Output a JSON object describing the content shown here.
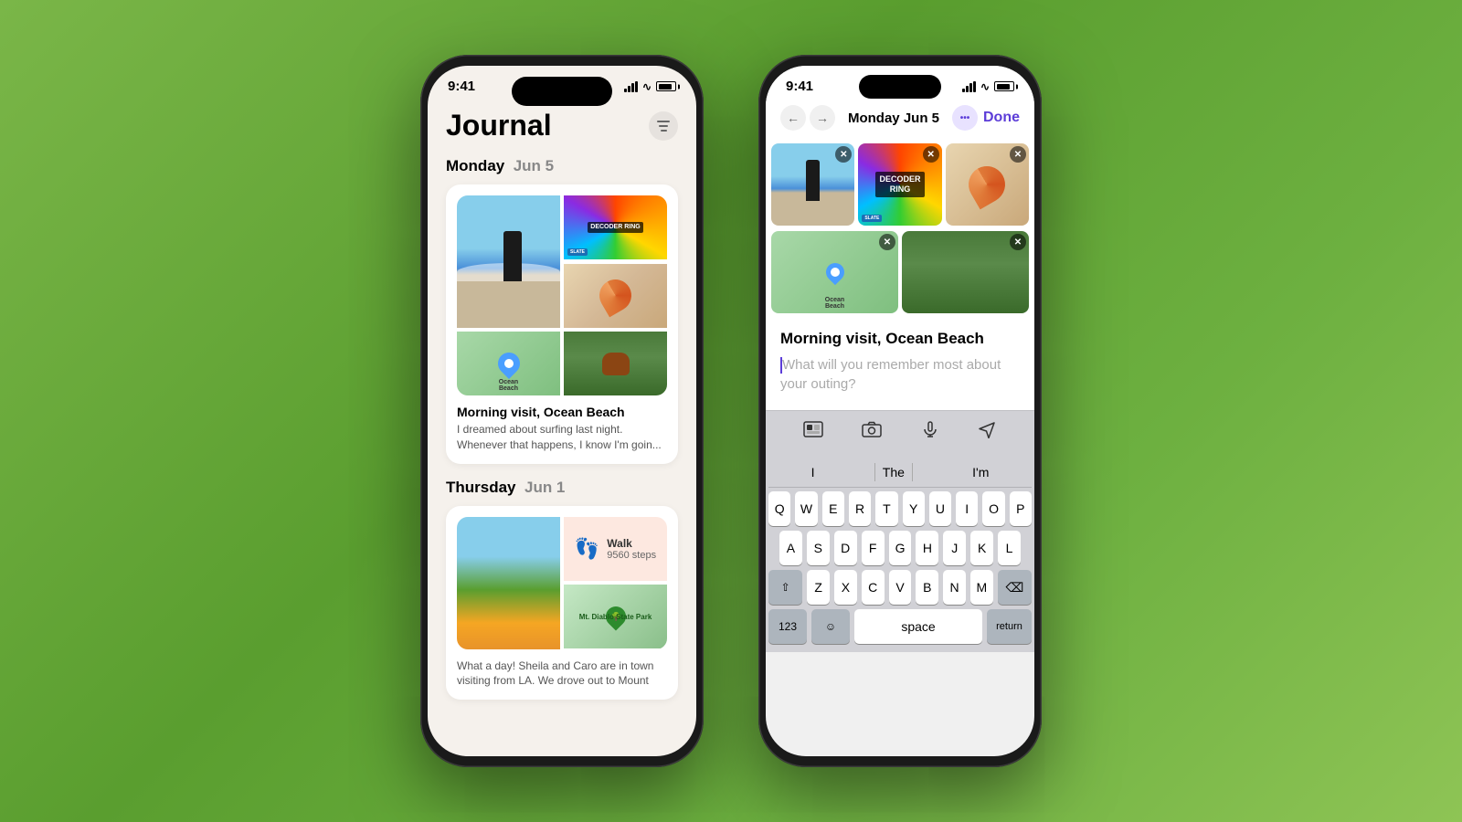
{
  "background": {
    "color": "#6db040"
  },
  "phone_left": {
    "status_bar": {
      "time": "9:41",
      "signal": "signal",
      "wifi": "wifi",
      "battery": "battery"
    },
    "journal": {
      "title": "Journal",
      "filter_label": "filter",
      "section1": {
        "day": "Monday",
        "date": "Jun 5"
      },
      "entry1": {
        "title": "Morning visit, Ocean Beach",
        "body": "I dreamed about surfing last night. Whenever that happens, I know I'm goin..."
      },
      "section2": {
        "day": "Thursday",
        "date": "Jun 1"
      },
      "entry2": {
        "walk_title": "Walk",
        "walk_steps": "9560 steps",
        "park_name": "Mt. Diablo State Park",
        "body": "What a day! Sheila and Caro are in town visiting from LA. We drove out to Mount"
      },
      "ocean_beach_label": "Ocean Beach",
      "decoder_ring_label": "DECODER RING",
      "slate_label": "SLATE"
    }
  },
  "phone_right": {
    "status_bar": {
      "time": "9:41",
      "signal": "signal",
      "wifi": "wifi",
      "battery": "battery"
    },
    "edit_view": {
      "back_btn": "←",
      "forward_btn": "→",
      "date": "Monday Jun 5",
      "more_btn": "•••",
      "done_btn": "Done",
      "entry_title": "Morning visit, Ocean Beach",
      "entry_placeholder": "What will you remember most about your outing?",
      "ocean_beach_label": "Ocean Beach",
      "decoder_ring_label": "DECODER RING",
      "slate_label": "SLATE"
    },
    "toolbar": {
      "photo_library": "photo-library",
      "camera": "camera",
      "audio": "audio",
      "location": "location"
    },
    "keyboard": {
      "suggestions": [
        "I",
        "The",
        "I'm"
      ],
      "rows": [
        [
          "Q",
          "W",
          "E",
          "R",
          "T",
          "Y",
          "U",
          "I",
          "O",
          "P"
        ],
        [
          "A",
          "S",
          "D",
          "F",
          "G",
          "H",
          "J",
          "K",
          "L"
        ],
        [
          "⇧",
          "Z",
          "X",
          "C",
          "V",
          "B",
          "N",
          "M",
          "⌫"
        ]
      ]
    }
  }
}
